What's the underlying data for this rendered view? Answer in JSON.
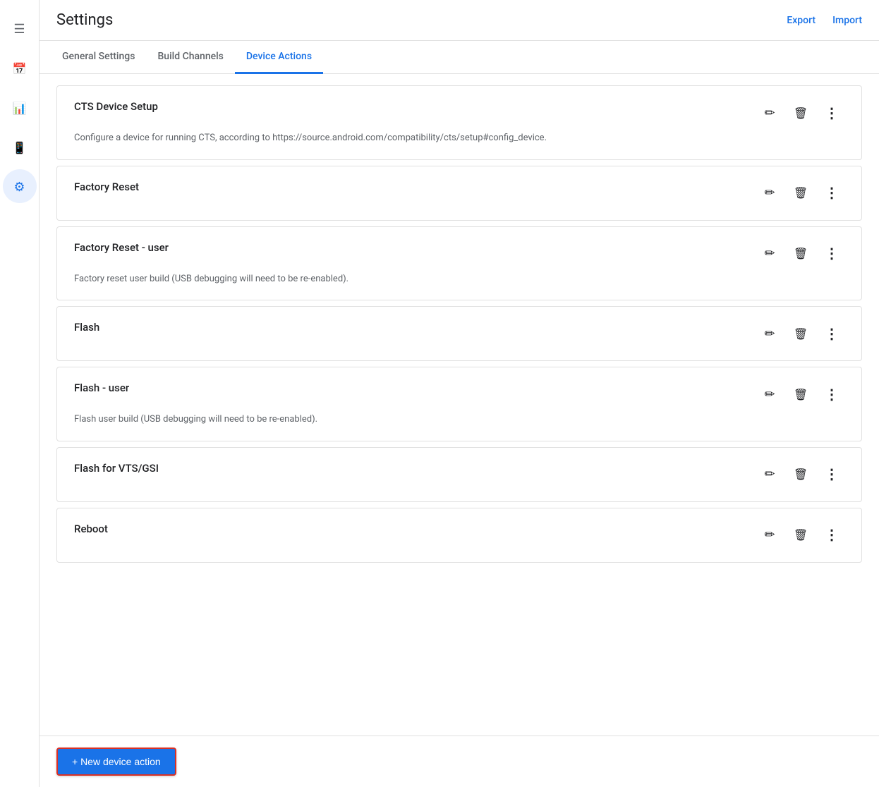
{
  "header": {
    "title": "Settings",
    "export_label": "Export",
    "import_label": "Import"
  },
  "tabs": [
    {
      "id": "general",
      "label": "General Settings",
      "active": false
    },
    {
      "id": "build",
      "label": "Build Channels",
      "active": false
    },
    {
      "id": "device",
      "label": "Device Actions",
      "active": true
    }
  ],
  "sidebar": {
    "items": [
      {
        "id": "list",
        "icon": "list",
        "active": false
      },
      {
        "id": "calendar",
        "icon": "calendar",
        "active": false
      },
      {
        "id": "bar-chart",
        "icon": "bar",
        "active": false
      },
      {
        "id": "phone",
        "icon": "phone",
        "active": false
      },
      {
        "id": "settings",
        "icon": "settings",
        "active": true
      }
    ]
  },
  "device_actions": [
    {
      "id": 1,
      "title": "CTS Device Setup",
      "description": "Configure a device for running CTS, according to https://source.android.com/compatibility/cts/setup#config_device."
    },
    {
      "id": 2,
      "title": "Factory Reset",
      "description": ""
    },
    {
      "id": 3,
      "title": "Factory Reset - user",
      "description": "Factory reset user build (USB debugging will need to be re-enabled)."
    },
    {
      "id": 4,
      "title": "Flash",
      "description": ""
    },
    {
      "id": 5,
      "title": "Flash - user",
      "description": "Flash user build (USB debugging will need to be re-enabled)."
    },
    {
      "id": 6,
      "title": "Flash for VTS/GSI",
      "description": ""
    },
    {
      "id": 7,
      "title": "Reboot",
      "description": ""
    }
  ],
  "footer": {
    "new_action_label": "+ New device action"
  }
}
